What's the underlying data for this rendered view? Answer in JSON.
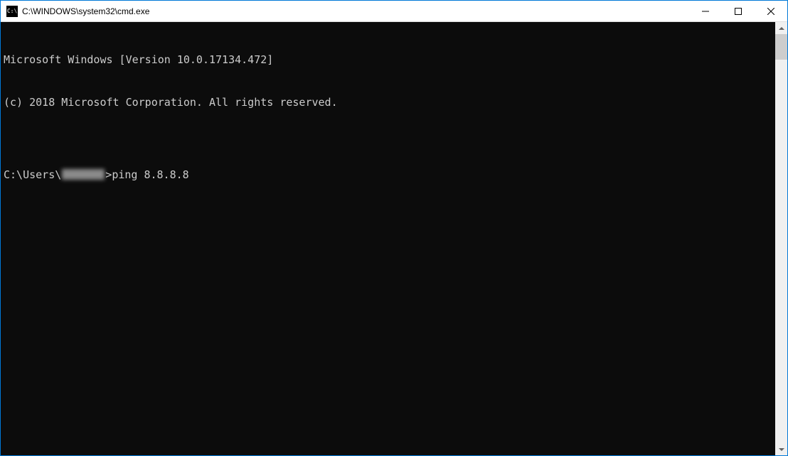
{
  "window": {
    "title": "C:\\WINDOWS\\system32\\cmd.exe",
    "icon_label": "C:\\"
  },
  "terminal": {
    "line1": "Microsoft Windows [Version 10.0.17134.472]",
    "line2": "(c) 2018 Microsoft Corporation. All rights reserved.",
    "blank": "",
    "prompt_prefix": "C:\\Users\\",
    "prompt_user": "[redacted]",
    "prompt_suffix": ">",
    "command": "ping 8.8.8.8"
  }
}
